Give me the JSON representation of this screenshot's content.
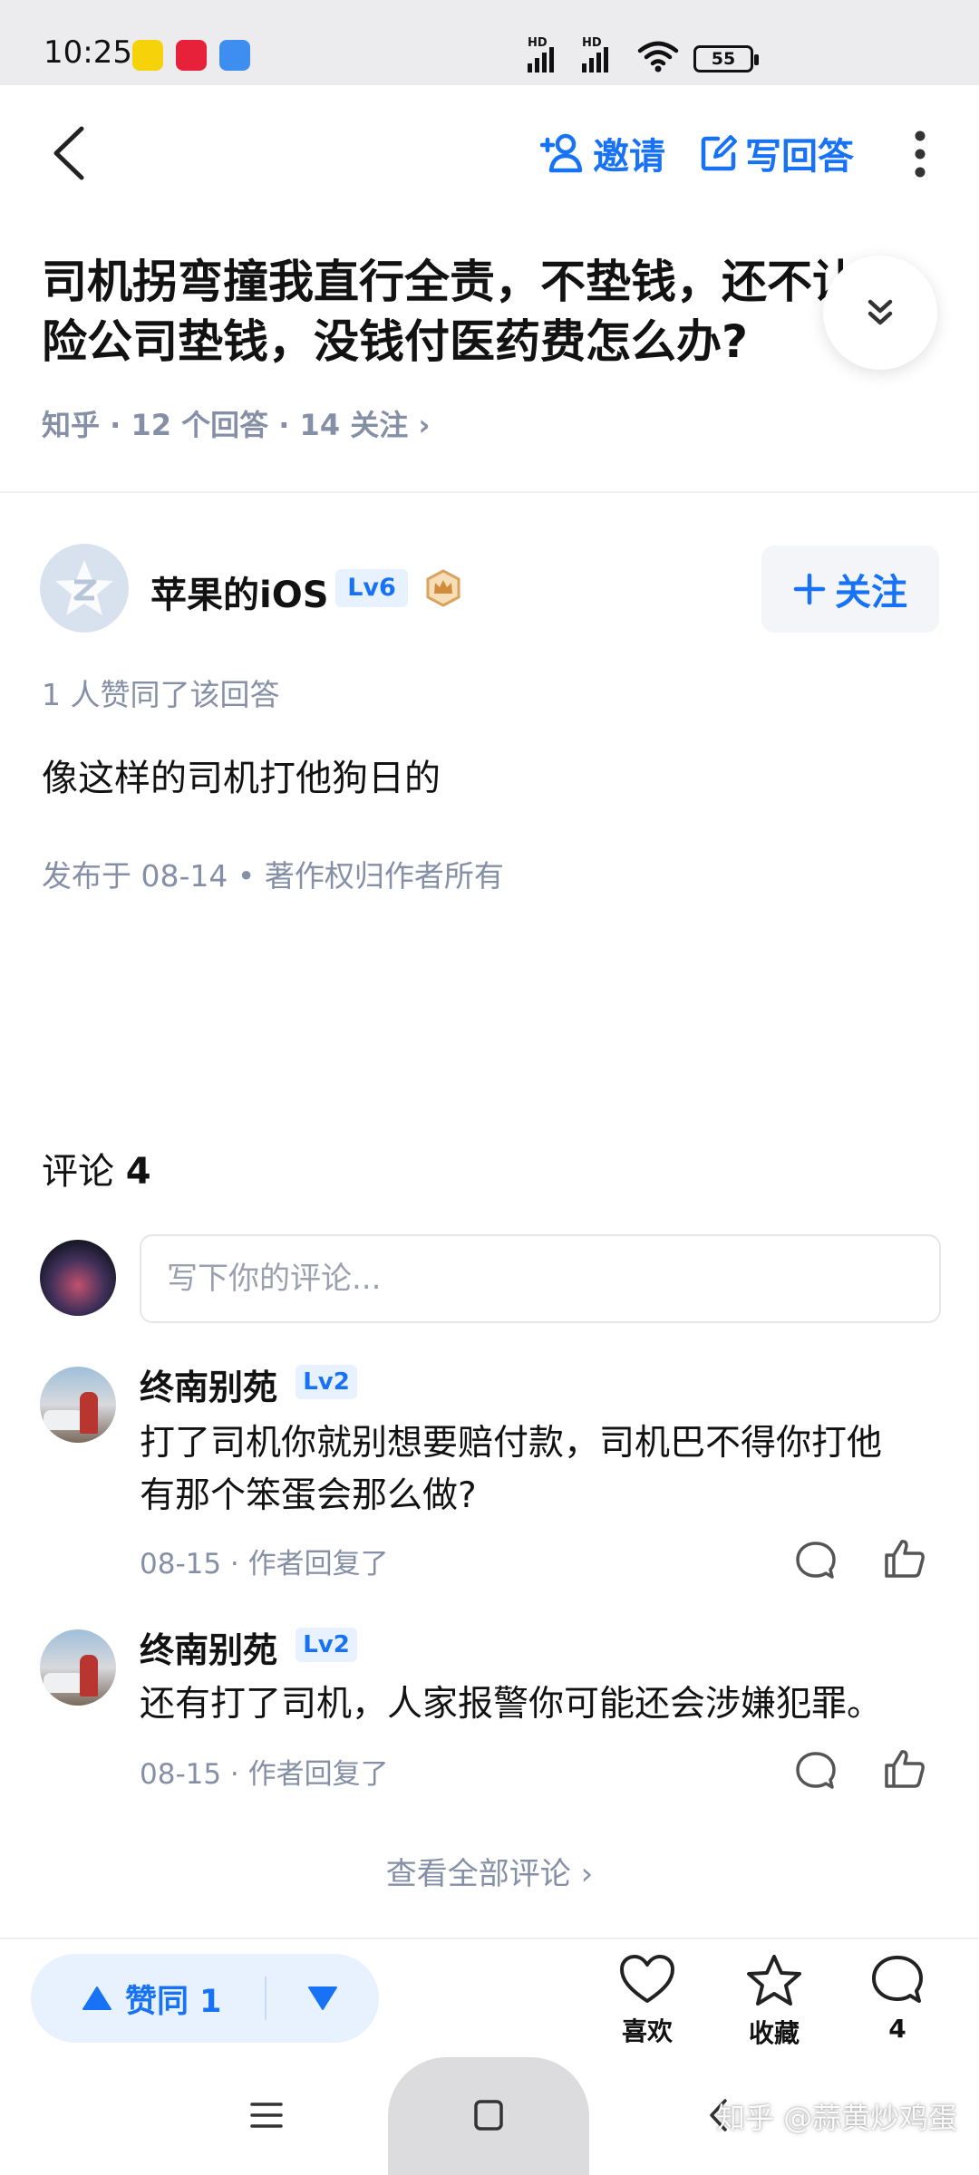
{
  "status_bar": {
    "time": "10:25",
    "battery": "55",
    "signal_label": "HD"
  },
  "nav": {
    "invite_label": "邀请",
    "write_answer_label": "写回答"
  },
  "question": {
    "title_line1": "司机拐弯撞我直行全责，不垫钱，还不让保",
    "title_line2": "险公司垫钱，没钱付医药费怎么办?",
    "meta": "知乎 · 12 个回答 · 14 关注 ›"
  },
  "answer": {
    "author_name": "苹果的iOS",
    "author_level": "Lv6",
    "follow_label": "关注",
    "likes_line": "1 人赞同了该回答",
    "body": "像这样的司机打他狗日的",
    "publish_line": "发布于 08-14 • 著作权归作者所有"
  },
  "comments": {
    "title_prefix": "评论",
    "count": "4",
    "input_placeholder": "写下你的评论...",
    "items": [
      {
        "name": "终南别苑",
        "level": "Lv2",
        "text_line1": "打了司机你就别想要赔付款，司机巴不得你打他",
        "text_line2": "有那个笨蛋会那么做?",
        "meta": "08-15 · 作者回复了"
      },
      {
        "name": "终南别苑",
        "level": "Lv2",
        "text_line1": "还有打了司机，人家报警你可能还会涉嫌犯罪。",
        "text_line2": "",
        "meta": "08-15 · 作者回复了"
      }
    ],
    "view_all": "查看全部评论 ›"
  },
  "bottom_bar": {
    "upvote_label": "赞同 1",
    "like_label": "喜欢",
    "favorite_label": "收藏",
    "comment_count": "4"
  },
  "watermark": "知乎 @蒜黄炒鸡蛋",
  "colors": {
    "accent": "#1772f6",
    "muted": "#8590a6",
    "text": "#121212"
  }
}
